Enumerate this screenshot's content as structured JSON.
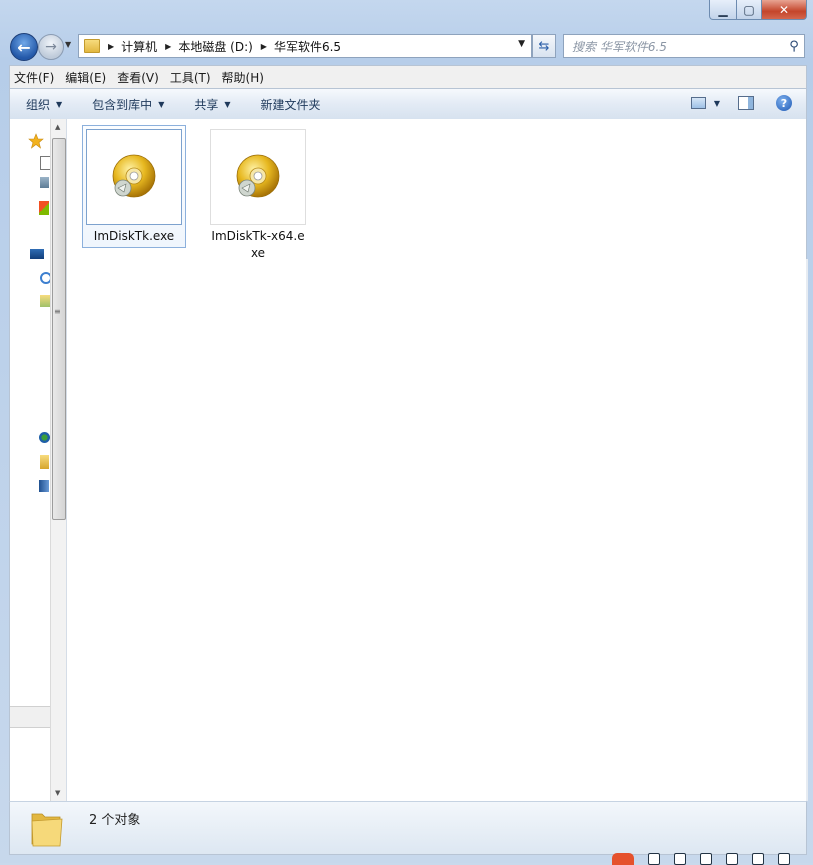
{
  "address": {
    "crumbs": [
      "计算机",
      "本地磁盘 (D:)",
      "华军软件6.5"
    ]
  },
  "search": {
    "placeholder": "搜索 华军软件6.5"
  },
  "menu": [
    "文件(F)",
    "编辑(E)",
    "查看(V)",
    "工具(T)",
    "帮助(H)"
  ],
  "toolbar": {
    "organize": "组织",
    "include_library": "包含到库中",
    "share": "共享",
    "new_folder": "新建文件夹"
  },
  "files": [
    {
      "name": "ImDiskTk.exe",
      "selected": true
    },
    {
      "name": "ImDiskTk-x64.exe",
      "selected": false
    }
  ],
  "status": {
    "count_text": "2 个对象"
  },
  "icons": {
    "file": "cd-installer-icon",
    "status": "folder-icon"
  },
  "colors": {
    "accent": "#2358a8",
    "disc": "#d9a91c"
  }
}
